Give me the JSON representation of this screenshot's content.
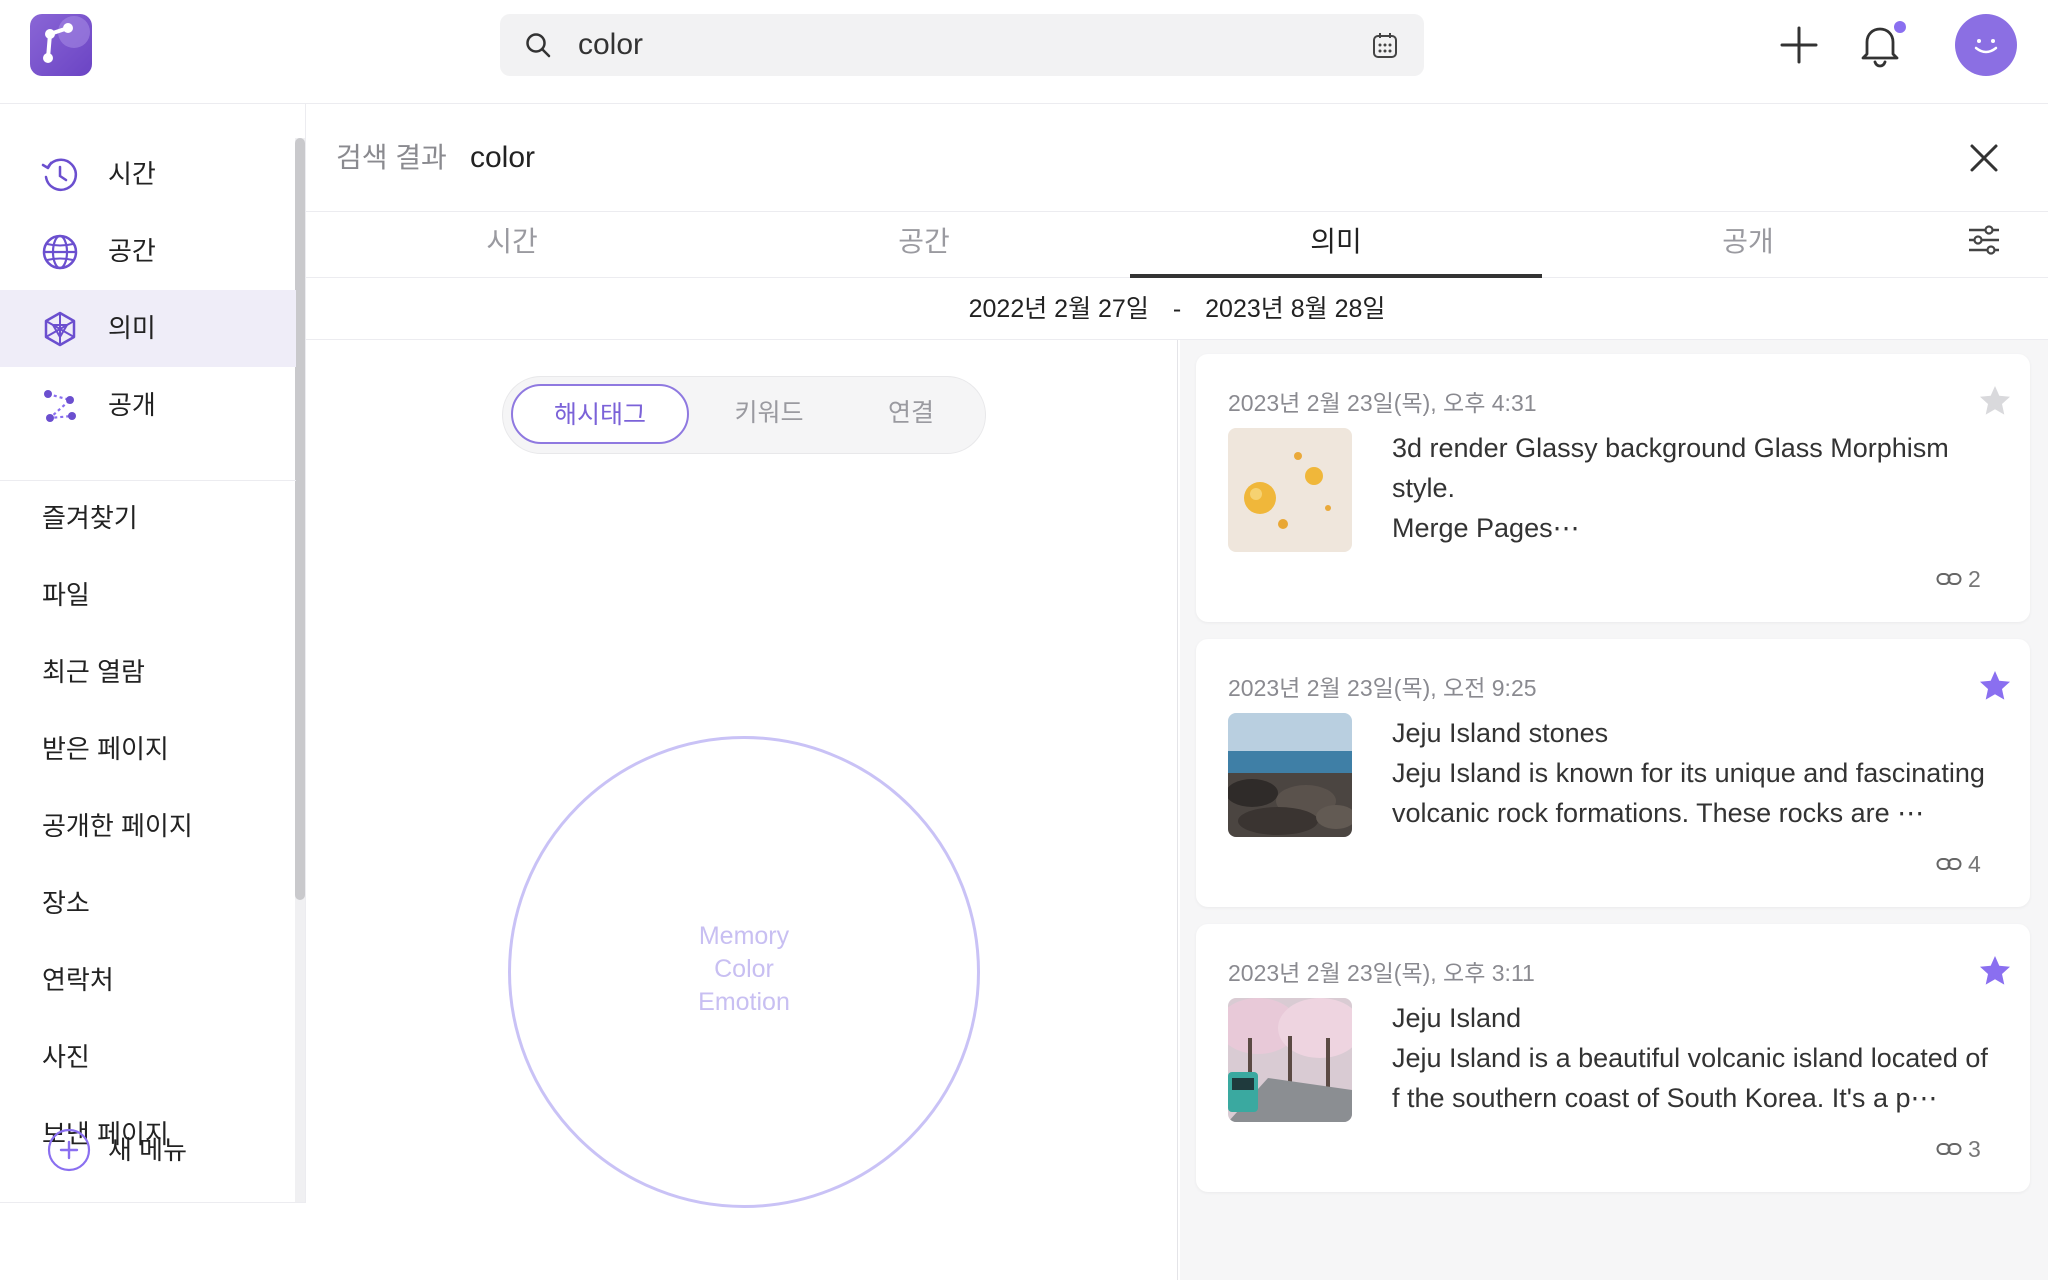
{
  "header": {
    "search": {
      "value": "color"
    }
  },
  "sidebar": {
    "nav": [
      {
        "label": "시간",
        "icon": "history-clock-icon"
      },
      {
        "label": "공간",
        "icon": "globe-icon"
      },
      {
        "label": "의미",
        "icon": "semantic-network-icon"
      },
      {
        "label": "공개",
        "icon": "share-nodes-icon"
      }
    ],
    "active_nav": "의미",
    "menu": [
      "즐겨찾기",
      "파일",
      "최근 열람",
      "받은 페이지",
      "공개한 페이지",
      "장소",
      "연락처",
      "사진",
      "보낸 페이지"
    ],
    "new_menu_label": "새 메뉴"
  },
  "main": {
    "results_label": "검색 결과",
    "query": "color",
    "tabs": [
      "시간",
      "공간",
      "의미",
      "공개"
    ],
    "active_tab": "의미",
    "date_range": {
      "start": "2022년 2월 27일",
      "separator": "-",
      "end": "2023년 8월 28일"
    },
    "segment": {
      "options": [
        "해시태그",
        "키워드",
        "연결"
      ],
      "selected": "해시태그"
    },
    "bubble": {
      "lines": [
        "Memory",
        "Color",
        "Emotion"
      ]
    }
  },
  "cards": [
    {
      "date": "2023년 2월 23일(목), 오후 4:31",
      "starred": false,
      "title": "3d render Glassy background Glass Morphism style.",
      "body": "Merge Pages⋯",
      "links": "2",
      "thumb": "gold-spheres"
    },
    {
      "date": "2023년 2월 23일(목), 오전 9:25",
      "starred": true,
      "title": "Jeju Island stones",
      "body": "Jeju Island is known for its unique and fascinating volcanic rock formations. These rocks are ⋯",
      "links": "4",
      "thumb": "rocky-coast"
    },
    {
      "date": "2023년 2월 23일(목), 오후 3:11",
      "starred": true,
      "title": "Jeju Island",
      "body": "Jeju Island is a beautiful volcanic island located off the southern coast of South Korea. It's a p⋯",
      "links": "3",
      "thumb": "cherry-blossom-road"
    }
  ],
  "colors": {
    "accent": "#7b62d8",
    "active_nav_bg": "#efedf8",
    "star_on": "#8a6ff0",
    "star_off": "#d9d9dc",
    "bubble_border": "#c9c2f6"
  }
}
